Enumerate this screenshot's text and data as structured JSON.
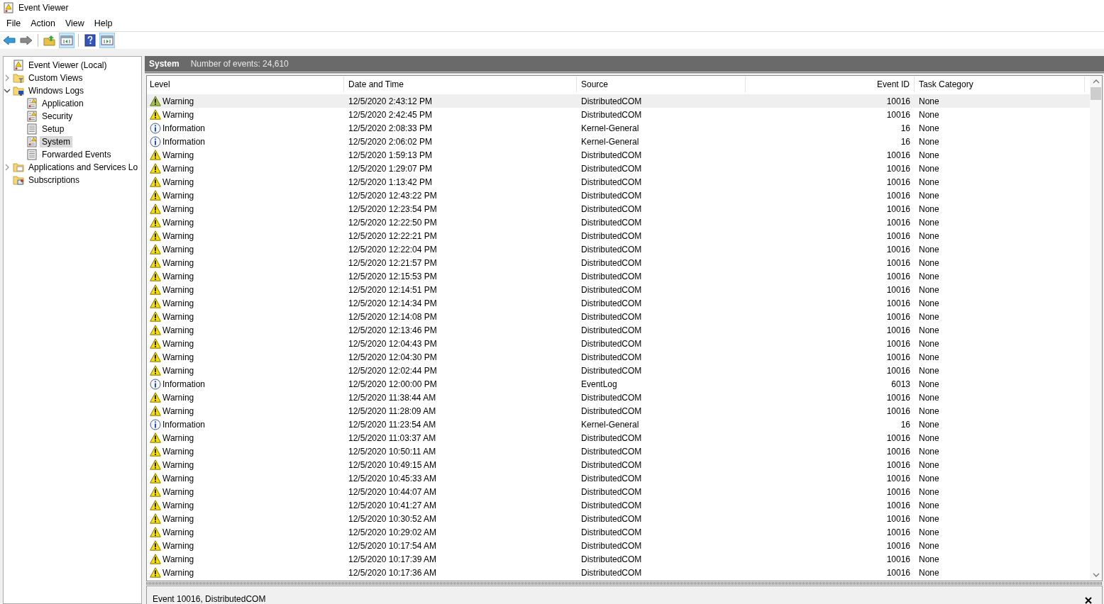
{
  "window": {
    "title": "Event Viewer"
  },
  "menu": [
    "File",
    "Action",
    "View",
    "Help"
  ],
  "toolbar": [
    {
      "kind": "back",
      "pressed": false
    },
    {
      "kind": "forward",
      "pressed": false
    },
    {
      "kind": "up",
      "pressed": false
    },
    {
      "kind": "tree",
      "pressed": true
    },
    {
      "kind": "help",
      "pressed": false
    },
    {
      "kind": "actions",
      "pressed": true
    }
  ],
  "tree": {
    "items": [
      {
        "label": "Event Viewer (Local)",
        "kind": "root",
        "selected": false,
        "children": [
          {
            "label": "Custom Views",
            "kind": "filter-folder",
            "selected": false,
            "expanded": false
          },
          {
            "label": "Windows Logs",
            "kind": "computer-folder",
            "selected": false,
            "expanded": true,
            "children": [
              {
                "label": "Application",
                "kind": "log",
                "selected": false
              },
              {
                "label": "Security",
                "kind": "log",
                "selected": false
              },
              {
                "label": "Setup",
                "kind": "plain-log",
                "selected": false
              },
              {
                "label": "System",
                "kind": "log",
                "selected": true
              },
              {
                "label": "Forwarded Events",
                "kind": "plain-log",
                "selected": false
              }
            ]
          },
          {
            "label": "Applications and Services Lo",
            "kind": "folder",
            "selected": false,
            "expanded": false
          },
          {
            "label": "Subscriptions",
            "kind": "subscriptions",
            "selected": false
          }
        ]
      }
    ]
  },
  "pane": {
    "title": "System",
    "subtitle": "Number of events: 24,610"
  },
  "table": {
    "columns": [
      "Level",
      "Date and Time",
      "Source",
      "Event ID",
      "Task Category"
    ],
    "rows": [
      {
        "kind": "warning",
        "level": "Warning",
        "date": "12/5/2020 2:43:12 PM",
        "source": "DistributedCOM",
        "event_id": "10016",
        "category": "None",
        "selected": true
      },
      {
        "kind": "warning",
        "level": "Warning",
        "date": "12/5/2020 2:42:45 PM",
        "source": "DistributedCOM",
        "event_id": "10016",
        "category": "None",
        "selected": false
      },
      {
        "kind": "information",
        "level": "Information",
        "date": "12/5/2020 2:08:33 PM",
        "source": "Kernel-General",
        "event_id": "16",
        "category": "None",
        "selected": false
      },
      {
        "kind": "information",
        "level": "Information",
        "date": "12/5/2020 2:06:02 PM",
        "source": "Kernel-General",
        "event_id": "16",
        "category": "None",
        "selected": false
      },
      {
        "kind": "warning",
        "level": "Warning",
        "date": "12/5/2020 1:59:13 PM",
        "source": "DistributedCOM",
        "event_id": "10016",
        "category": "None",
        "selected": false
      },
      {
        "kind": "warning",
        "level": "Warning",
        "date": "12/5/2020 1:29:07 PM",
        "source": "DistributedCOM",
        "event_id": "10016",
        "category": "None",
        "selected": false
      },
      {
        "kind": "warning",
        "level": "Warning",
        "date": "12/5/2020 1:13:42 PM",
        "source": "DistributedCOM",
        "event_id": "10016",
        "category": "None",
        "selected": false
      },
      {
        "kind": "warning",
        "level": "Warning",
        "date": "12/5/2020 12:43:22 PM",
        "source": "DistributedCOM",
        "event_id": "10016",
        "category": "None",
        "selected": false
      },
      {
        "kind": "warning",
        "level": "Warning",
        "date": "12/5/2020 12:23:54 PM",
        "source": "DistributedCOM",
        "event_id": "10016",
        "category": "None",
        "selected": false
      },
      {
        "kind": "warning",
        "level": "Warning",
        "date": "12/5/2020 12:22:50 PM",
        "source": "DistributedCOM",
        "event_id": "10016",
        "category": "None",
        "selected": false
      },
      {
        "kind": "warning",
        "level": "Warning",
        "date": "12/5/2020 12:22:21 PM",
        "source": "DistributedCOM",
        "event_id": "10016",
        "category": "None",
        "selected": false
      },
      {
        "kind": "warning",
        "level": "Warning",
        "date": "12/5/2020 12:22:04 PM",
        "source": "DistributedCOM",
        "event_id": "10016",
        "category": "None",
        "selected": false
      },
      {
        "kind": "warning",
        "level": "Warning",
        "date": "12/5/2020 12:21:57 PM",
        "source": "DistributedCOM",
        "event_id": "10016",
        "category": "None",
        "selected": false
      },
      {
        "kind": "warning",
        "level": "Warning",
        "date": "12/5/2020 12:15:53 PM",
        "source": "DistributedCOM",
        "event_id": "10016",
        "category": "None",
        "selected": false
      },
      {
        "kind": "warning",
        "level": "Warning",
        "date": "12/5/2020 12:14:51 PM",
        "source": "DistributedCOM",
        "event_id": "10016",
        "category": "None",
        "selected": false
      },
      {
        "kind": "warning",
        "level": "Warning",
        "date": "12/5/2020 12:14:34 PM",
        "source": "DistributedCOM",
        "event_id": "10016",
        "category": "None",
        "selected": false
      },
      {
        "kind": "warning",
        "level": "Warning",
        "date": "12/5/2020 12:14:08 PM",
        "source": "DistributedCOM",
        "event_id": "10016",
        "category": "None",
        "selected": false
      },
      {
        "kind": "warning",
        "level": "Warning",
        "date": "12/5/2020 12:13:46 PM",
        "source": "DistributedCOM",
        "event_id": "10016",
        "category": "None",
        "selected": false
      },
      {
        "kind": "warning",
        "level": "Warning",
        "date": "12/5/2020 12:04:43 PM",
        "source": "DistributedCOM",
        "event_id": "10016",
        "category": "None",
        "selected": false
      },
      {
        "kind": "warning",
        "level": "Warning",
        "date": "12/5/2020 12:04:30 PM",
        "source": "DistributedCOM",
        "event_id": "10016",
        "category": "None",
        "selected": false
      },
      {
        "kind": "warning",
        "level": "Warning",
        "date": "12/5/2020 12:02:44 PM",
        "source": "DistributedCOM",
        "event_id": "10016",
        "category": "None",
        "selected": false
      },
      {
        "kind": "information",
        "level": "Information",
        "date": "12/5/2020 12:00:00 PM",
        "source": "EventLog",
        "event_id": "6013",
        "category": "None",
        "selected": false
      },
      {
        "kind": "warning",
        "level": "Warning",
        "date": "12/5/2020 11:38:44 AM",
        "source": "DistributedCOM",
        "event_id": "10016",
        "category": "None",
        "selected": false
      },
      {
        "kind": "warning",
        "level": "Warning",
        "date": "12/5/2020 11:28:09 AM",
        "source": "DistributedCOM",
        "event_id": "10016",
        "category": "None",
        "selected": false
      },
      {
        "kind": "information",
        "level": "Information",
        "date": "12/5/2020 11:23:54 AM",
        "source": "Kernel-General",
        "event_id": "16",
        "category": "None",
        "selected": false
      },
      {
        "kind": "warning",
        "level": "Warning",
        "date": "12/5/2020 11:03:37 AM",
        "source": "DistributedCOM",
        "event_id": "10016",
        "category": "None",
        "selected": false
      },
      {
        "kind": "warning",
        "level": "Warning",
        "date": "12/5/2020 10:50:11 AM",
        "source": "DistributedCOM",
        "event_id": "10016",
        "category": "None",
        "selected": false
      },
      {
        "kind": "warning",
        "level": "Warning",
        "date": "12/5/2020 10:49:15 AM",
        "source": "DistributedCOM",
        "event_id": "10016",
        "category": "None",
        "selected": false
      },
      {
        "kind": "warning",
        "level": "Warning",
        "date": "12/5/2020 10:45:33 AM",
        "source": "DistributedCOM",
        "event_id": "10016",
        "category": "None",
        "selected": false
      },
      {
        "kind": "warning",
        "level": "Warning",
        "date": "12/5/2020 10:44:07 AM",
        "source": "DistributedCOM",
        "event_id": "10016",
        "category": "None",
        "selected": false
      },
      {
        "kind": "warning",
        "level": "Warning",
        "date": "12/5/2020 10:41:27 AM",
        "source": "DistributedCOM",
        "event_id": "10016",
        "category": "None",
        "selected": false
      },
      {
        "kind": "warning",
        "level": "Warning",
        "date": "12/5/2020 10:30:52 AM",
        "source": "DistributedCOM",
        "event_id": "10016",
        "category": "None",
        "selected": false
      },
      {
        "kind": "warning",
        "level": "Warning",
        "date": "12/5/2020 10:29:02 AM",
        "source": "DistributedCOM",
        "event_id": "10016",
        "category": "None",
        "selected": false
      },
      {
        "kind": "warning",
        "level": "Warning",
        "date": "12/5/2020 10:17:54 AM",
        "source": "DistributedCOM",
        "event_id": "10016",
        "category": "None",
        "selected": false
      },
      {
        "kind": "warning",
        "level": "Warning",
        "date": "12/5/2020 10:17:39 AM",
        "source": "DistributedCOM",
        "event_id": "10016",
        "category": "None",
        "selected": false
      },
      {
        "kind": "warning",
        "level": "Warning",
        "date": "12/5/2020 10:17:36 AM",
        "source": "DistributedCOM",
        "event_id": "10016",
        "category": "None",
        "selected": false
      }
    ]
  },
  "details": {
    "title": "Event 10016, DistributedCOM"
  }
}
